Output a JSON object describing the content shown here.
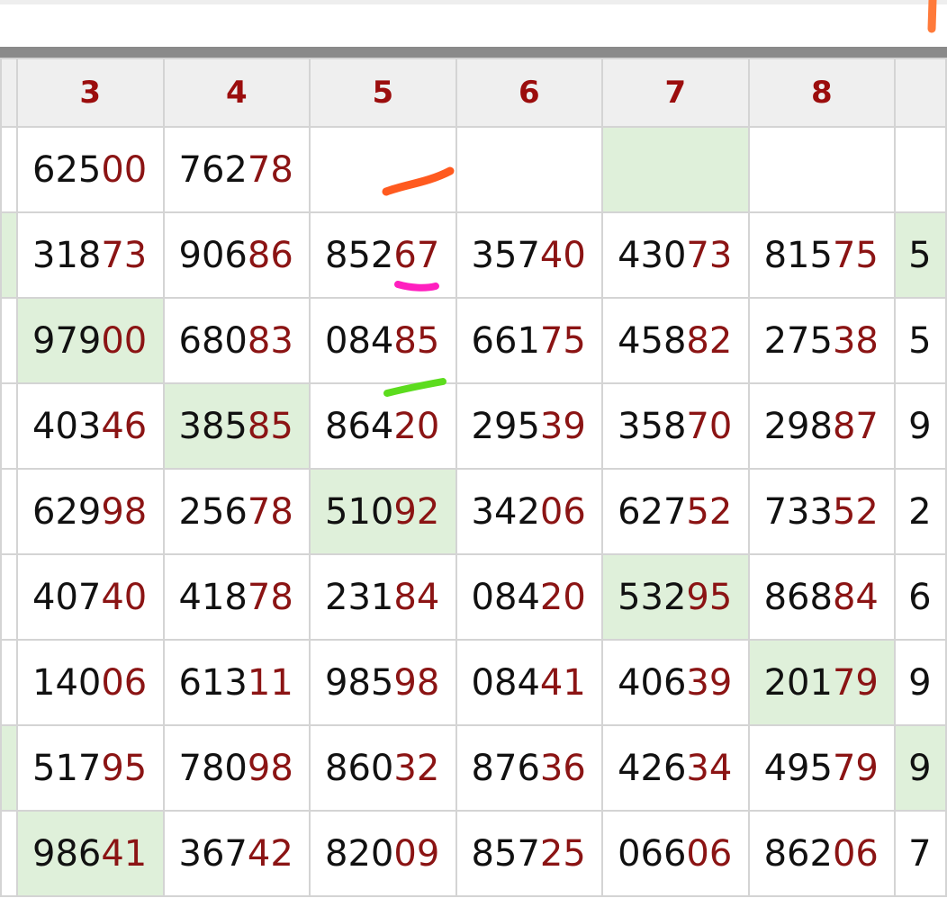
{
  "columns": [
    {
      "label": ""
    },
    {
      "label": "3"
    },
    {
      "label": "4"
    },
    {
      "label": "5"
    },
    {
      "label": "6"
    },
    {
      "label": "7"
    },
    {
      "label": "8"
    },
    {
      "label": ""
    }
  ],
  "rows": [
    {
      "cells": [
        {
          "head": "",
          "tail": "",
          "highlight": false
        },
        {
          "head": "625",
          "tail": "00",
          "highlight": false
        },
        {
          "head": "762",
          "tail": "78",
          "highlight": false
        },
        {
          "head": "",
          "tail": "",
          "highlight": false
        },
        {
          "head": "",
          "tail": "",
          "highlight": false
        },
        {
          "head": "",
          "tail": "",
          "highlight": true
        },
        {
          "head": "",
          "tail": "",
          "highlight": false
        },
        {
          "head": "",
          "tail": "",
          "highlight": false
        }
      ]
    },
    {
      "cells": [
        {
          "head": "",
          "tail": "",
          "highlight": true
        },
        {
          "head": "318",
          "tail": "73",
          "highlight": false
        },
        {
          "head": "906",
          "tail": "86",
          "highlight": false
        },
        {
          "head": "852",
          "tail": "67",
          "highlight": false
        },
        {
          "head": "357",
          "tail": "40",
          "highlight": false
        },
        {
          "head": "430",
          "tail": "73",
          "highlight": false
        },
        {
          "head": "815",
          "tail": "75",
          "highlight": false
        },
        {
          "head": "5",
          "tail": "",
          "highlight": true
        }
      ]
    },
    {
      "cells": [
        {
          "head": "",
          "tail": "",
          "highlight": false
        },
        {
          "head": "979",
          "tail": "00",
          "highlight": true
        },
        {
          "head": "680",
          "tail": "83",
          "highlight": false
        },
        {
          "head": "084",
          "tail": "85",
          "highlight": false
        },
        {
          "head": "661",
          "tail": "75",
          "highlight": false
        },
        {
          "head": "458",
          "tail": "82",
          "highlight": false
        },
        {
          "head": "275",
          "tail": "38",
          "highlight": false
        },
        {
          "head": "5",
          "tail": "",
          "highlight": false
        }
      ]
    },
    {
      "cells": [
        {
          "head": "",
          "tail": "",
          "highlight": false
        },
        {
          "head": "403",
          "tail": "46",
          "highlight": false
        },
        {
          "head": "385",
          "tail": "85",
          "highlight": true
        },
        {
          "head": "864",
          "tail": "20",
          "highlight": false
        },
        {
          "head": "295",
          "tail": "39",
          "highlight": false
        },
        {
          "head": "358",
          "tail": "70",
          "highlight": false
        },
        {
          "head": "298",
          "tail": "87",
          "highlight": false
        },
        {
          "head": "9",
          "tail": "",
          "highlight": false
        }
      ]
    },
    {
      "cells": [
        {
          "head": "",
          "tail": "",
          "highlight": false
        },
        {
          "head": "629",
          "tail": "98",
          "highlight": false
        },
        {
          "head": "256",
          "tail": "78",
          "highlight": false
        },
        {
          "head": "510",
          "tail": "92",
          "highlight": true
        },
        {
          "head": "342",
          "tail": "06",
          "highlight": false
        },
        {
          "head": "627",
          "tail": "52",
          "highlight": false
        },
        {
          "head": "733",
          "tail": "52",
          "highlight": false
        },
        {
          "head": "2",
          "tail": "",
          "highlight": false
        }
      ]
    },
    {
      "cells": [
        {
          "head": "",
          "tail": "",
          "highlight": false
        },
        {
          "head": "407",
          "tail": "40",
          "highlight": false
        },
        {
          "head": "418",
          "tail": "78",
          "highlight": false
        },
        {
          "head": "231",
          "tail": "84",
          "highlight": false
        },
        {
          "head": "084",
          "tail": "20",
          "highlight": false
        },
        {
          "head": "532",
          "tail": "95",
          "highlight": true
        },
        {
          "head": "868",
          "tail": "84",
          "highlight": false
        },
        {
          "head": "6",
          "tail": "",
          "highlight": false
        }
      ]
    },
    {
      "cells": [
        {
          "head": "",
          "tail": "",
          "highlight": false
        },
        {
          "head": "140",
          "tail": "06",
          "highlight": false
        },
        {
          "head": "613",
          "tail": "11",
          "highlight": false
        },
        {
          "head": "985",
          "tail": "98",
          "highlight": false
        },
        {
          "head": "084",
          "tail": "41",
          "highlight": false
        },
        {
          "head": "406",
          "tail": "39",
          "highlight": false
        },
        {
          "head": "201",
          "tail": "79",
          "highlight": true
        },
        {
          "head": "9",
          "tail": "",
          "highlight": false
        }
      ]
    },
    {
      "cells": [
        {
          "head": "",
          "tail": "",
          "highlight": true
        },
        {
          "head": "517",
          "tail": "95",
          "highlight": false
        },
        {
          "head": "780",
          "tail": "98",
          "highlight": false
        },
        {
          "head": "860",
          "tail": "32",
          "highlight": false
        },
        {
          "head": "876",
          "tail": "36",
          "highlight": false
        },
        {
          "head": "426",
          "tail": "34",
          "highlight": false
        },
        {
          "head": "495",
          "tail": "79",
          "highlight": false
        },
        {
          "head": "9",
          "tail": "",
          "highlight": true
        }
      ]
    },
    {
      "cells": [
        {
          "head": "",
          "tail": "",
          "highlight": false
        },
        {
          "head": "986",
          "tail": "41",
          "highlight": true
        },
        {
          "head": "367",
          "tail": "42",
          "highlight": false
        },
        {
          "head": "820",
          "tail": "09",
          "highlight": false
        },
        {
          "head": "857",
          "tail": "25",
          "highlight": false
        },
        {
          "head": "066",
          "tail": "06",
          "highlight": false
        },
        {
          "head": "862",
          "tail": "06",
          "highlight": false
        },
        {
          "head": "7",
          "tail": "",
          "highlight": false
        }
      ]
    }
  ],
  "colors": {
    "header_text": "#9b0d0d",
    "tail_digits": "#8b1414",
    "highlight_cell": "#dff0da",
    "mark_orange": "#ff5a1f",
    "mark_pink": "#ff1fbf",
    "mark_green": "#5cdc1e"
  },
  "annotations": [
    {
      "name": "orange-pen-stroke",
      "color": "orange"
    },
    {
      "name": "pink-pen-stroke",
      "color": "pink"
    },
    {
      "name": "green-pen-stroke",
      "color": "green"
    },
    {
      "name": "orange-edge-stroke",
      "color": "orange"
    }
  ]
}
